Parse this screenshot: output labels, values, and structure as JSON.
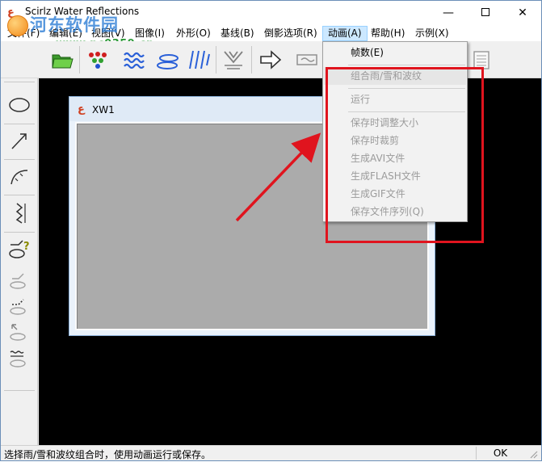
{
  "window": {
    "title": "Scirlz Water Reflections",
    "minimize_glyph": "—",
    "close_glyph": "✕"
  },
  "watermark": {
    "text": "河东软件园",
    "url": "www.pc0359.cn"
  },
  "menu": {
    "items": [
      {
        "label": "文件(F)"
      },
      {
        "label": "编辑(E)"
      },
      {
        "label": "视图(V)"
      },
      {
        "label": "图像(I)"
      },
      {
        "label": "外形(O)"
      },
      {
        "label": "基线(B)"
      },
      {
        "label": "倒影选项(R)"
      },
      {
        "label": "动画(A)",
        "active": true
      },
      {
        "label": "帮助(H)"
      },
      {
        "label": "示例(X)"
      }
    ]
  },
  "animation_menu": {
    "items": [
      {
        "label": "帧数(E)",
        "enabled": true
      },
      {
        "label": "组合雨/雪和波纹",
        "enabled": false,
        "highlighted": true
      },
      {
        "label": "运行",
        "enabled": false
      },
      {
        "label": "保存时调整大小",
        "enabled": false
      },
      {
        "label": "保存时裁剪",
        "enabled": false
      },
      {
        "label": "生成AVI文件",
        "enabled": false
      },
      {
        "label": "生成FLASH文件",
        "enabled": false
      },
      {
        "label": "生成GIF文件",
        "enabled": false
      },
      {
        "label": "保存文件序列(Q)",
        "enabled": false
      }
    ]
  },
  "child_window": {
    "title": "XW1"
  },
  "status": {
    "message": "选择雨/雪和波纹组合时，使用动画运行或保存。",
    "indicator": "OK"
  },
  "colors": {
    "annotation": "#e0141e",
    "canvas": "#000000",
    "menu_active": "#cce8ff"
  }
}
